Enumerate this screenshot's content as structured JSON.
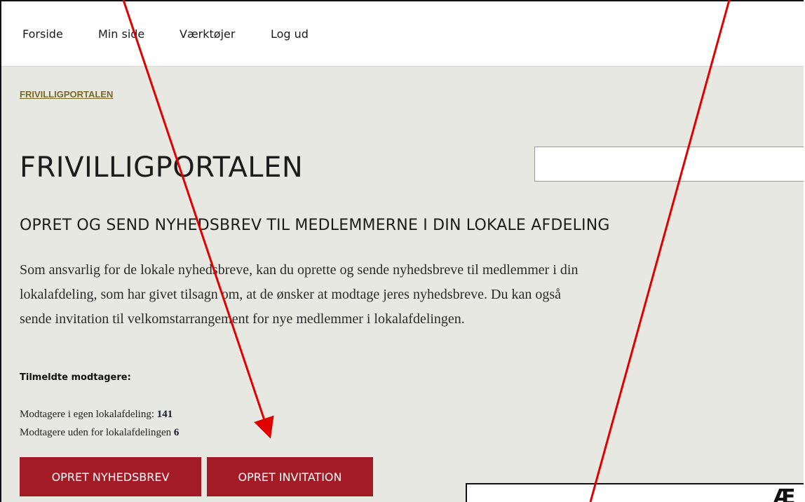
{
  "nav": {
    "items": [
      "Forside",
      "Min side",
      "Værktøjer",
      "Log ud"
    ]
  },
  "breadcrumb": "FRIVILLIGPORTALEN",
  "page_title": "FRIVILLIGPORTALEN",
  "search": {
    "value": "",
    "placeholder": ""
  },
  "subheading": "OPRET OG SEND NYHEDSBREV TIL MEDLEMMERNE I DIN LOKALE AFDELING",
  "intro_lines": [
    "Som ansvarlig for de lokale nyhedsbreve, kan du oprette og sende nyhedsbreve til medlemmer i din",
    "lokalafdeling, som har givet tilsagn om, at de ønsker at modtage jeres nyhedsbreve. Du kan også",
    "sende invitation til velkomstarrangement for nye medlemmer i lokalafdelingen."
  ],
  "recipients": {
    "label": "Tilmeldte modtagere:",
    "own_label": "Modtagere i egen lokalafdeling: ",
    "own_count": "141",
    "other_label": "Modtagere uden for lokalafdelingen ",
    "other_count": "6"
  },
  "buttons": {
    "create_newsletter": "OPRET NYHEDSBREV",
    "create_invitation": "OPRET INVITATION"
  },
  "overlay": {
    "glyph": "Æ"
  },
  "colors": {
    "accent": "#a31b25",
    "background": "#e8e8e2",
    "annotation_arrow": "#e00000"
  }
}
